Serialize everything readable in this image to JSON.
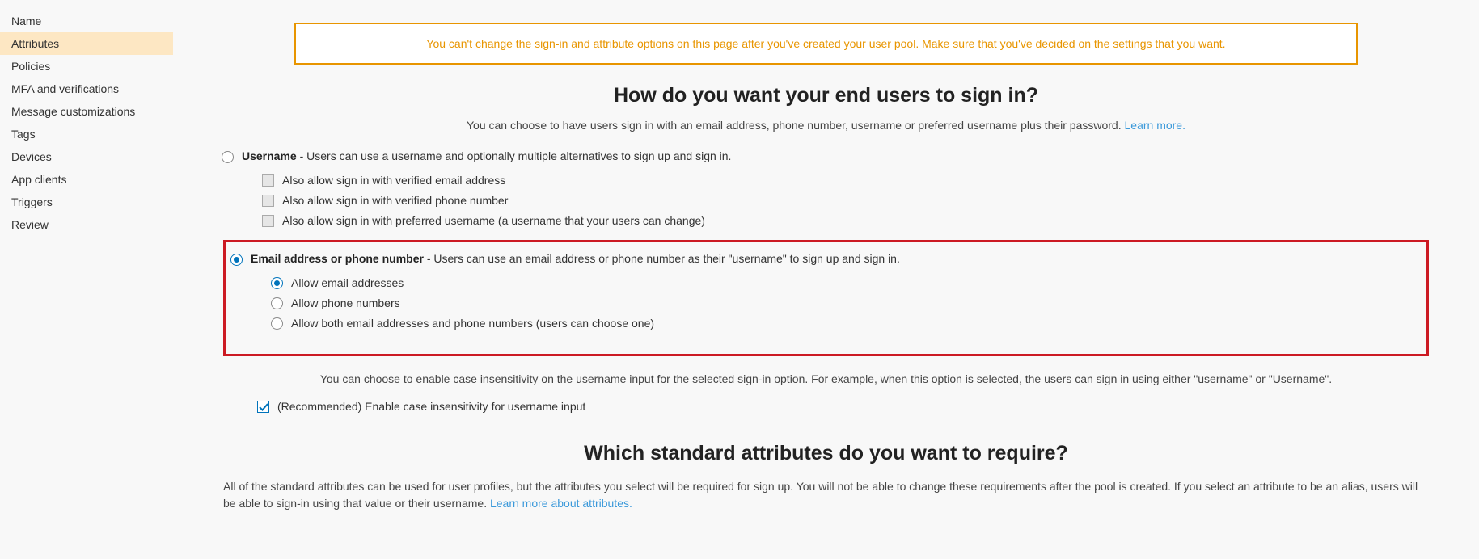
{
  "sidebar": {
    "items": [
      {
        "label": "Name"
      },
      {
        "label": "Attributes"
      },
      {
        "label": "Policies"
      },
      {
        "label": "MFA and verifications"
      },
      {
        "label": "Message customizations"
      },
      {
        "label": "Tags"
      },
      {
        "label": "Devices"
      },
      {
        "label": "App clients"
      },
      {
        "label": "Triggers"
      },
      {
        "label": "Review"
      }
    ]
  },
  "warning": "You can't change the sign-in and attribute options on this page after you've created your user pool. Make sure that you've decided on the settings that you want.",
  "heading1": "How do you want your end users to sign in?",
  "sub1_text": "You can choose to have users sign in with an email address, phone number, username or preferred username plus their password. ",
  "sub1_link": "Learn more.",
  "opt_username_bold": "Username",
  "opt_username_desc": " - Users can use a username and optionally multiple alternatives to sign up and sign in.",
  "username_sub1": "Also allow sign in with verified email address",
  "username_sub2": "Also allow sign in with verified phone number",
  "username_sub3": "Also allow sign in with preferred username (a username that your users can change)",
  "opt_email_bold": "Email address or phone number",
  "opt_email_desc": " - Users can use an email address or phone number as their \"username\" to sign up and sign in.",
  "email_sub1": "Allow email addresses",
  "email_sub2": "Allow phone numbers",
  "email_sub3": "Allow both email addresses and phone numbers (users can choose one)",
  "case_text": "You can choose to enable case insensitivity on the username input for the selected sign-in option. For example, when this option is selected, the users can sign in using either \"username\" or \"Username\".",
  "case_checkbox": "(Recommended) Enable case insensitivity for username input",
  "heading2": "Which standard attributes do you want to require?",
  "section2_text": "All of the standard attributes can be used for user profiles, but the attributes you select will be required for sign up. You will not be able to change these requirements after the pool is created. If you select an attribute to be an alias, users will be able to sign-in using that value or their username. ",
  "section2_link": "Learn more about attributes."
}
